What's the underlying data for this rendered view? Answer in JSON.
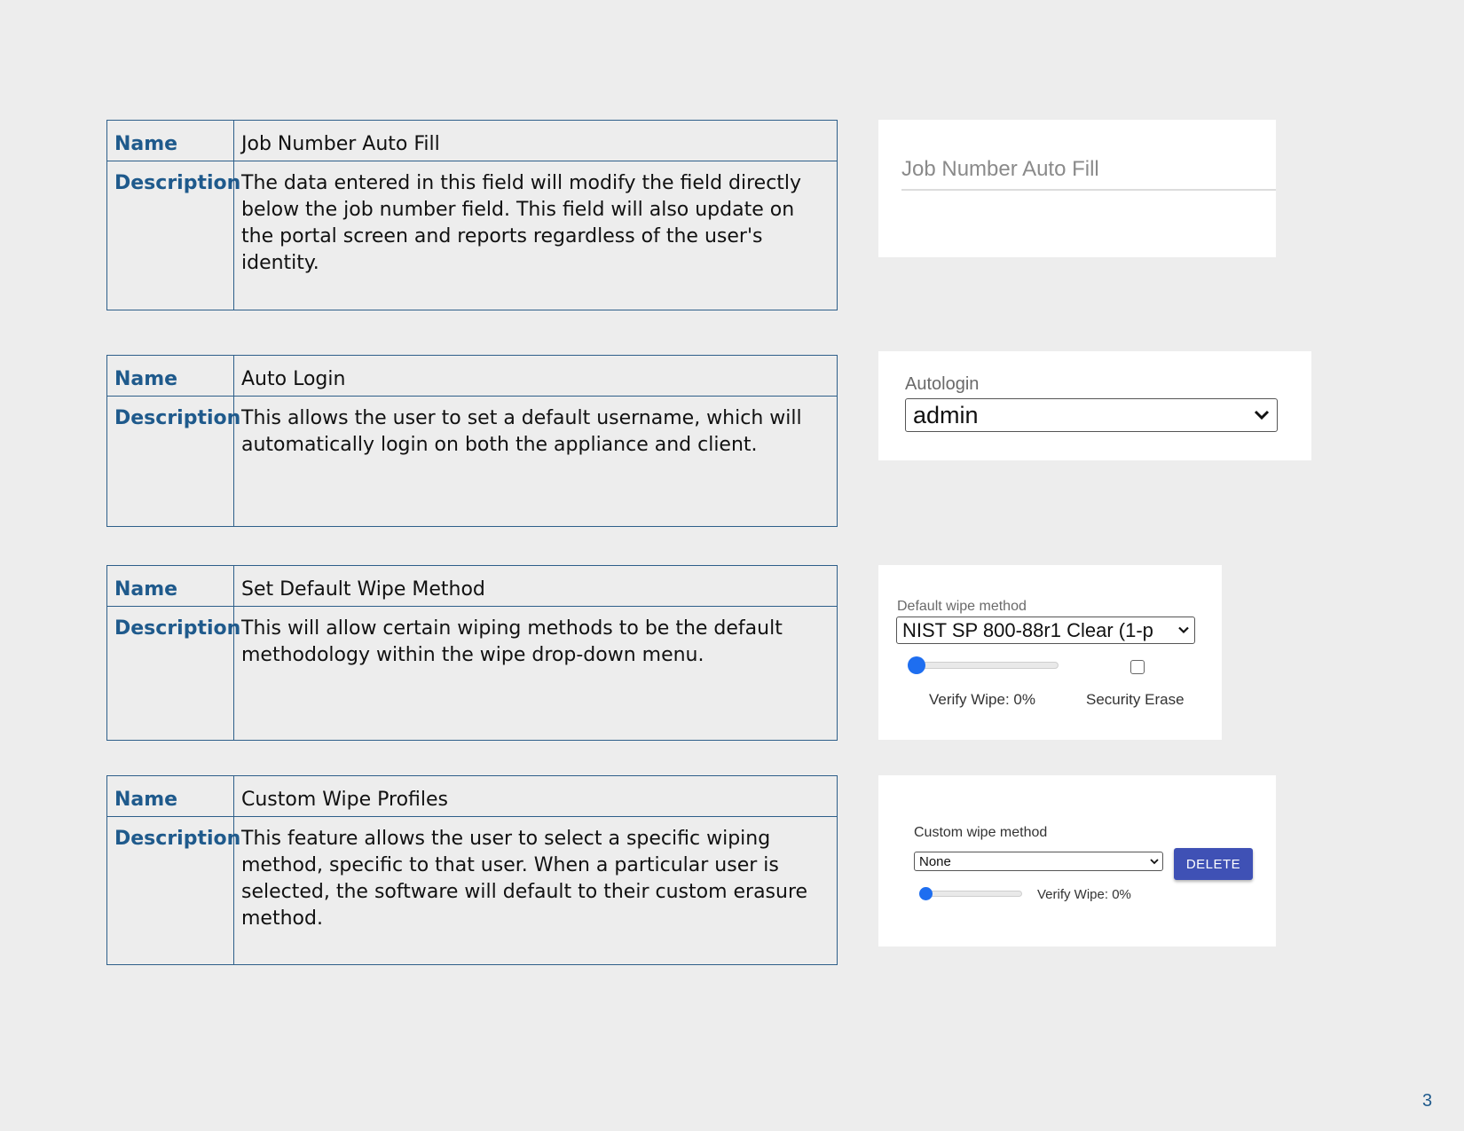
{
  "features": [
    {
      "name_key": "Name",
      "name": "Job Number Auto Fill",
      "desc_key": "Description",
      "description": "The data entered in this field will modify the field directly below the job number field. This field will also update on the portal screen and reports regardless of the user's identity."
    },
    {
      "name_key": "Name",
      "name": "Auto Login",
      "desc_key": "Description",
      "description": "This allows the user to set a default username, which will automatically login on both the appliance and client."
    },
    {
      "name_key": "Name",
      "name": "Set Default Wipe Method",
      "desc_key": "Description",
      "description": "This will allow certain wiping methods to be the default methodology within the wipe drop-down menu."
    },
    {
      "name_key": "Name",
      "name": "Custom Wipe Profiles",
      "desc_key": "Description",
      "description": "This feature allows the user to select a specific wiping method, specific to that user. When a particular user is selected, the software will default to their custom erasure method."
    }
  ],
  "job_number_panel": {
    "placeholder": "Job Number Auto Fill"
  },
  "autologin_panel": {
    "label": "Autologin",
    "selected": "admin"
  },
  "default_wipe_panel": {
    "label": "Default wipe method",
    "selected": "NIST SP 800-88r1 Clear (1-p",
    "verify_label": "Verify Wipe: 0%",
    "verify_percent": 0,
    "security_erase_label": "Security Erase",
    "security_erase_checked": false
  },
  "custom_wipe_panel": {
    "label": "Custom wipe method",
    "selected": "None",
    "delete_label": "DELETE",
    "verify_label": "Verify Wipe: 0%",
    "verify_percent": 0
  },
  "colors": {
    "accent_blue": "#1f5a8c",
    "table_border": "#2e5f8a",
    "slider_thumb": "#1e6ef0",
    "delete_button": "#3f51b5"
  },
  "page_number": "3"
}
